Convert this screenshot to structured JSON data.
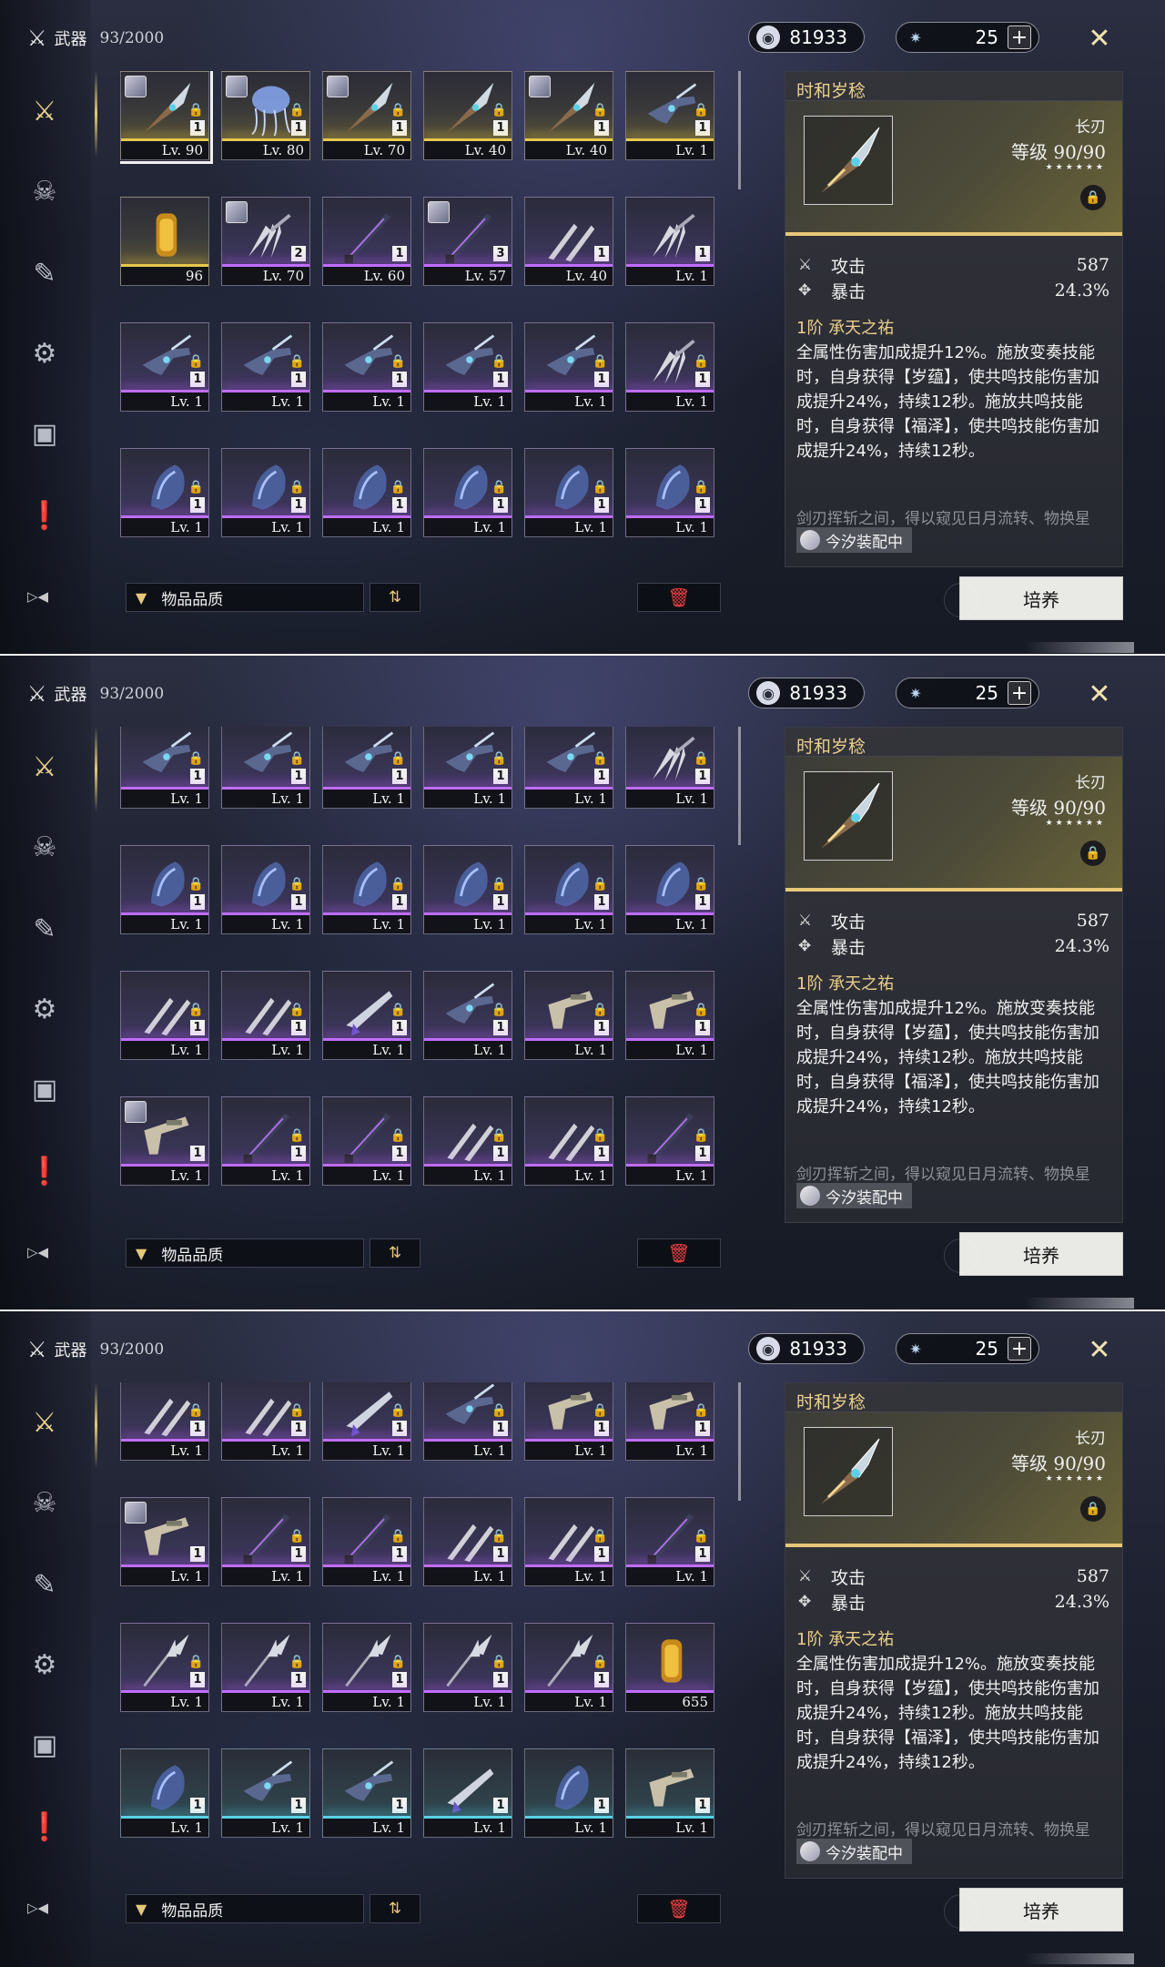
{
  "header": {
    "category": "武器",
    "capacity": "93/2000"
  },
  "currency": {
    "primary": "81933",
    "secondary": "25"
  },
  "sidebar": {
    "items": [
      "weapon",
      "echo",
      "supply",
      "resources",
      "materials",
      "quest-items",
      "switch-view"
    ]
  },
  "filter": {
    "label": "物品品质"
  },
  "actions": {
    "upgrade": "培养"
  },
  "detail": {
    "name": "时和岁稔",
    "type": "长刃",
    "level_label": "等级",
    "level": "90/90",
    "stars": "★★★★★★",
    "stats": [
      {
        "label": "攻击",
        "value": "587"
      },
      {
        "label": "暴击",
        "value": "24.3%"
      }
    ],
    "passive_rank": "1阶",
    "passive_name": "承天之祐",
    "passive_desc": "全属性伤害加成提升12%。施放变奏技能时，自身获得【岁蕴】，使共鸣技能伤害加成提升24%，持续12秒。施放共鸣技能时，自身获得【福泽】，使共鸣技能伤害加成提升24%，持续12秒。",
    "flavor": "剑刃挥斩之间，得以窥见日月流转、物换星",
    "equipped": "今汐装配中"
  },
  "panels": [
    {
      "scroll_offset": 0,
      "rows": [
        [
          {
            "r": "r5",
            "lv": "Lv. 90",
            "rank": "1",
            "lock": true,
            "av": true,
            "sel": true,
            "w": "glaive"
          },
          {
            "r": "r5",
            "lv": "Lv. 80",
            "rank": "1",
            "lock": true,
            "av": true,
            "w": "jelly"
          },
          {
            "r": "r5",
            "lv": "Lv. 70",
            "rank": "1",
            "lock": true,
            "av": true,
            "w": "glaive"
          },
          {
            "r": "r5",
            "lv": "Lv. 40",
            "rank": "1",
            "lock": true,
            "w": "glaive"
          },
          {
            "r": "r5",
            "lv": "Lv. 40",
            "rank": "1",
            "lock": true,
            "av": true,
            "w": "glaive"
          },
          {
            "r": "r5",
            "lv": "Lv. 1",
            "rank": "1",
            "lock": true,
            "w": "gun"
          }
        ],
        [
          {
            "r": "r5",
            "lv": "96",
            "w": "can"
          },
          {
            "r": "r4",
            "lv": "Lv. 70",
            "rank": "2",
            "av": true,
            "w": "claws"
          },
          {
            "r": "r4",
            "lv": "Lv. 60",
            "rank": "1",
            "w": "sword"
          },
          {
            "r": "r4",
            "lv": "Lv. 57",
            "rank": "3",
            "av": true,
            "w": "sword"
          },
          {
            "r": "r4",
            "lv": "Lv. 40",
            "rank": "1",
            "w": "twin"
          },
          {
            "r": "r4",
            "lv": "Lv. 1",
            "rank": "1",
            "w": "claws"
          }
        ],
        [
          {
            "r": "r4",
            "lv": "Lv. 1",
            "rank": "1",
            "lock": true,
            "w": "gun"
          },
          {
            "r": "r4",
            "lv": "Lv. 1",
            "rank": "1",
            "lock": true,
            "w": "gun"
          },
          {
            "r": "r4",
            "lv": "Lv. 1",
            "rank": "1",
            "lock": true,
            "w": "gun"
          },
          {
            "r": "r4",
            "lv": "Lv. 1",
            "rank": "1",
            "lock": true,
            "w": "gun"
          },
          {
            "r": "r4",
            "lv": "Lv. 1",
            "rank": "1",
            "lock": true,
            "w": "gun"
          },
          {
            "r": "r4",
            "lv": "Lv. 1",
            "rank": "1",
            "lock": true,
            "w": "claws"
          }
        ],
        [
          {
            "r": "r4",
            "lv": "Lv. 1",
            "rank": "1",
            "lock": true,
            "w": "gauntlet"
          },
          {
            "r": "r4",
            "lv": "Lv. 1",
            "rank": "1",
            "lock": true,
            "w": "gauntlet"
          },
          {
            "r": "r4",
            "lv": "Lv. 1",
            "rank": "1",
            "lock": true,
            "w": "gauntlet"
          },
          {
            "r": "r4",
            "lv": "Lv. 1",
            "rank": "1",
            "lock": true,
            "w": "gauntlet"
          },
          {
            "r": "r4",
            "lv": "Lv. 1",
            "rank": "1",
            "lock": true,
            "w": "gauntlet"
          },
          {
            "r": "r4",
            "lv": "Lv. 1",
            "rank": "1",
            "lock": true,
            "w": "gauntlet"
          }
        ]
      ]
    },
    {
      "scroll_offset": 0,
      "rows": [
        [
          {
            "r": "r4",
            "lv": "Lv. 1",
            "rank": "1",
            "lock": true,
            "w": "gun"
          },
          {
            "r": "r4",
            "lv": "Lv. 1",
            "rank": "1",
            "lock": true,
            "w": "gun"
          },
          {
            "r": "r4",
            "lv": "Lv. 1",
            "rank": "1",
            "lock": true,
            "w": "gun"
          },
          {
            "r": "r4",
            "lv": "Lv. 1",
            "rank": "1",
            "lock": true,
            "w": "gun"
          },
          {
            "r": "r4",
            "lv": "Lv. 1",
            "rank": "1",
            "lock": true,
            "w": "gun"
          },
          {
            "r": "r4",
            "lv": "Lv. 1",
            "rank": "1",
            "lock": true,
            "w": "claws"
          }
        ],
        [
          {
            "r": "r4",
            "lv": "Lv. 1",
            "rank": "1",
            "lock": true,
            "w": "gauntlet"
          },
          {
            "r": "r4",
            "lv": "Lv. 1",
            "rank": "1",
            "lock": true,
            "w": "gauntlet"
          },
          {
            "r": "r4",
            "lv": "Lv. 1",
            "rank": "1",
            "lock": true,
            "w": "gauntlet"
          },
          {
            "r": "r4",
            "lv": "Lv. 1",
            "rank": "1",
            "lock": true,
            "w": "gauntlet"
          },
          {
            "r": "r4",
            "lv": "Lv. 1",
            "rank": "1",
            "lock": true,
            "w": "gauntlet"
          },
          {
            "r": "r4",
            "lv": "Lv. 1",
            "rank": "1",
            "lock": true,
            "w": "gauntlet"
          }
        ],
        [
          {
            "r": "r4",
            "lv": "Lv. 1",
            "rank": "1",
            "lock": true,
            "w": "twin"
          },
          {
            "r": "r4",
            "lv": "Lv. 1",
            "rank": "1",
            "lock": true,
            "w": "twin"
          },
          {
            "r": "r4",
            "lv": "Lv. 1",
            "rank": "1",
            "lock": true,
            "w": "blade"
          },
          {
            "r": "r4",
            "lv": "Lv. 1",
            "rank": "1",
            "lock": true,
            "w": "gun"
          },
          {
            "r": "r4",
            "lv": "Lv. 1",
            "rank": "1",
            "lock": true,
            "w": "pistol"
          },
          {
            "r": "r4",
            "lv": "Lv. 1",
            "rank": "1",
            "lock": true,
            "w": "pistol"
          }
        ],
        [
          {
            "r": "r4",
            "lv": "Lv. 1",
            "rank": "1",
            "av": true,
            "w": "pistol"
          },
          {
            "r": "r4",
            "lv": "Lv. 1",
            "rank": "1",
            "lock": true,
            "w": "sword"
          },
          {
            "r": "r4",
            "lv": "Lv. 1",
            "rank": "1",
            "lock": true,
            "w": "sword"
          },
          {
            "r": "r4",
            "lv": "Lv. 1",
            "rank": "1",
            "lock": true,
            "w": "twin"
          },
          {
            "r": "r4",
            "lv": "Lv. 1",
            "rank": "1",
            "lock": true,
            "w": "twin"
          },
          {
            "r": "r4",
            "lv": "Lv. 1",
            "rank": "1",
            "lock": true,
            "w": "sword"
          }
        ],
        [
          {
            "r": "r4",
            "w": "sword"
          },
          {
            "r": "r4",
            "w": "sword"
          },
          {
            "r": "r4",
            "w": "sword"
          },
          {
            "r": "r4",
            "w": "sword"
          },
          {
            "r": "r4",
            "w": "sword"
          },
          {
            "r": "r4",
            "w": "sword"
          }
        ]
      ]
    },
    {
      "scroll_offset": 0,
      "rows": [
        [
          {
            "r": "r4",
            "lv": "Lv. 1",
            "rank": "1",
            "lock": true,
            "w": "twin"
          },
          {
            "r": "r4",
            "lv": "Lv. 1",
            "rank": "1",
            "lock": true,
            "w": "twin"
          },
          {
            "r": "r4",
            "lv": "Lv. 1",
            "rank": "1",
            "lock": true,
            "w": "blade"
          },
          {
            "r": "r4",
            "lv": "Lv. 1",
            "rank": "1",
            "lock": true,
            "w": "gun"
          },
          {
            "r": "r4",
            "lv": "Lv. 1",
            "rank": "1",
            "lock": true,
            "w": "pistol"
          },
          {
            "r": "r4",
            "lv": "Lv. 1",
            "rank": "1",
            "lock": true,
            "w": "pistol"
          }
        ],
        [
          {
            "r": "r4",
            "lv": "Lv. 1",
            "rank": "1",
            "av": true,
            "w": "pistol"
          },
          {
            "r": "r4",
            "lv": "Lv. 1",
            "rank": "1",
            "lock": true,
            "w": "sword"
          },
          {
            "r": "r4",
            "lv": "Lv. 1",
            "rank": "1",
            "lock": true,
            "w": "sword"
          },
          {
            "r": "r4",
            "lv": "Lv. 1",
            "rank": "1",
            "lock": true,
            "w": "twin"
          },
          {
            "r": "r4",
            "lv": "Lv. 1",
            "rank": "1",
            "lock": true,
            "w": "twin"
          },
          {
            "r": "r4",
            "lv": "Lv. 1",
            "rank": "1",
            "lock": true,
            "w": "sword"
          }
        ],
        [
          {
            "r": "r4",
            "lv": "Lv. 1",
            "rank": "1",
            "lock": true,
            "w": "spear"
          },
          {
            "r": "r4",
            "lv": "Lv. 1",
            "rank": "1",
            "lock": true,
            "w": "spear"
          },
          {
            "r": "r4",
            "lv": "Lv. 1",
            "rank": "1",
            "lock": true,
            "w": "spear"
          },
          {
            "r": "r4",
            "lv": "Lv. 1",
            "rank": "1",
            "lock": true,
            "w": "spear"
          },
          {
            "r": "r4",
            "lv": "Lv. 1",
            "rank": "1",
            "lock": true,
            "w": "spear"
          },
          {
            "r": "r4",
            "lv": "655",
            "w": "can"
          }
        ],
        [
          {
            "r": "r3",
            "lv": "Lv. 1",
            "rank": "1",
            "w": "gauntlet"
          },
          {
            "r": "r3",
            "lv": "Lv. 1",
            "rank": "1",
            "w": "gun"
          },
          {
            "r": "r3",
            "lv": "Lv. 1",
            "rank": "1",
            "w": "gun"
          },
          {
            "r": "r3",
            "lv": "Lv. 1",
            "rank": "1",
            "w": "blade"
          },
          {
            "r": "r3",
            "lv": "Lv. 1",
            "rank": "1",
            "w": "gauntlet"
          },
          {
            "r": "r3",
            "lv": "Lv. 1",
            "rank": "1",
            "w": "pistol"
          }
        ],
        [
          {
            "r": "r3",
            "w": "sword"
          },
          {
            "r": "r3",
            "w": "sword"
          },
          {
            "r": "r3",
            "w": "sword"
          },
          {
            "r": "r3",
            "w": "sword"
          },
          {
            "r": "r3",
            "w": "sword"
          },
          {
            "r": "r3",
            "w": "sword"
          }
        ]
      ]
    }
  ]
}
